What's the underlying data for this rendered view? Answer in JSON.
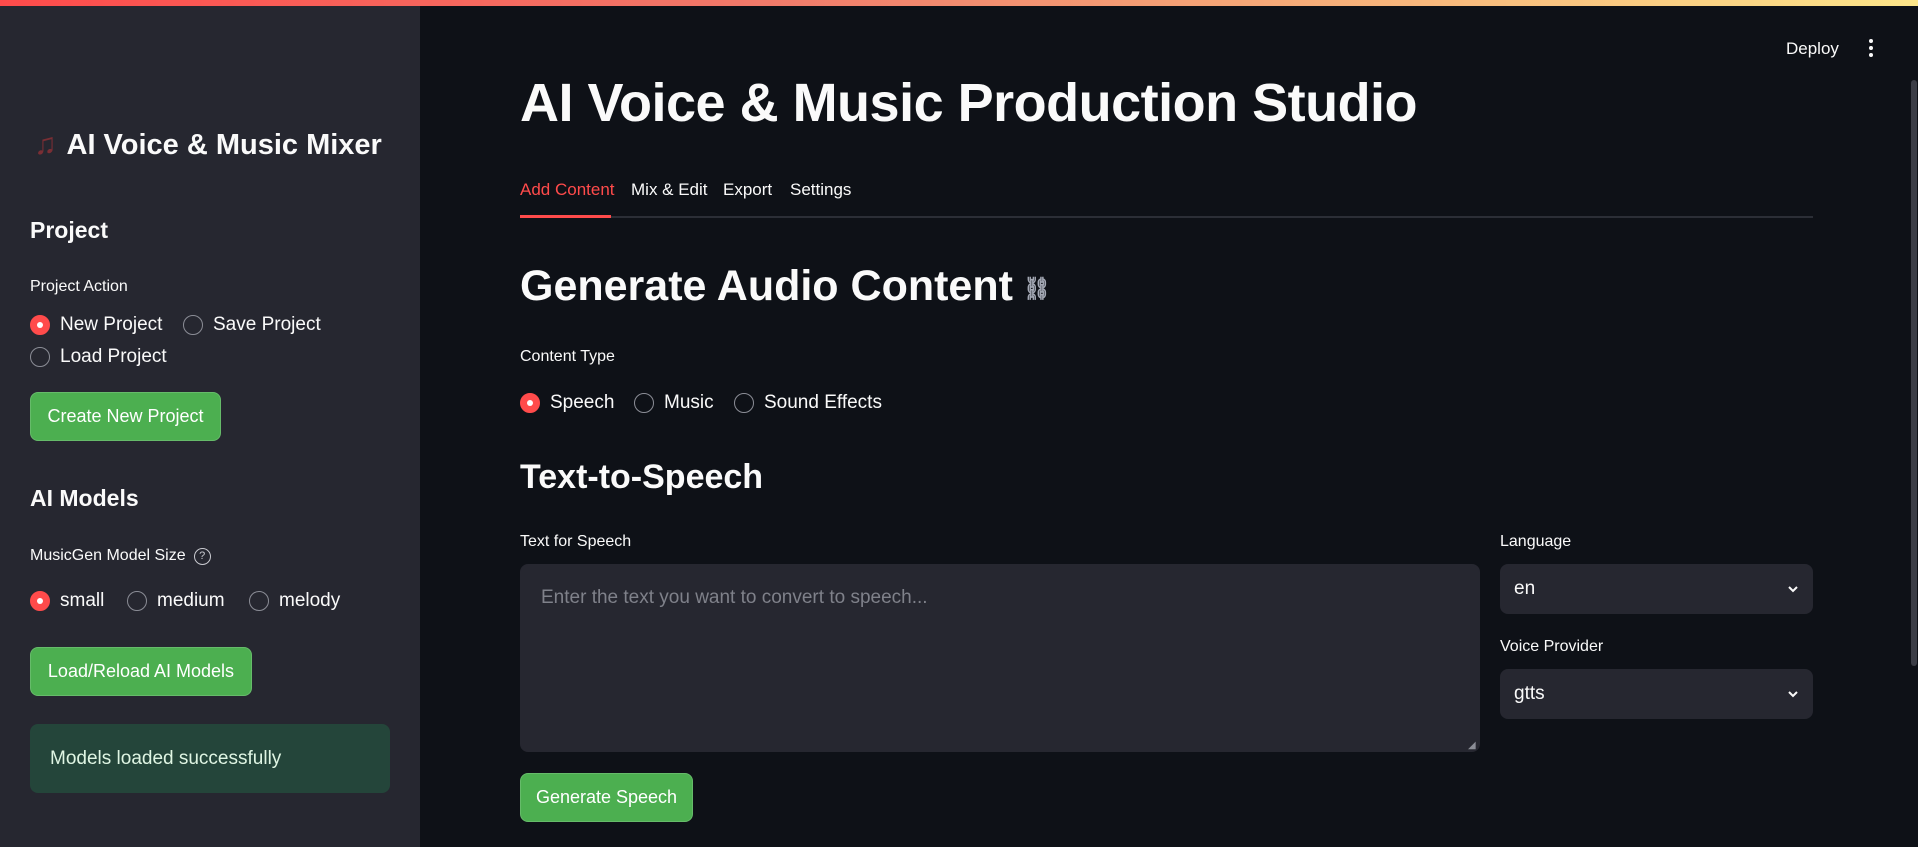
{
  "sidebar": {
    "title": "AI Voice & Music Mixer",
    "title_icon": "music-note-icon",
    "project": {
      "heading": "Project",
      "action_label": "Project Action",
      "options": [
        "New Project",
        "Save Project",
        "Load Project"
      ],
      "selected": "New Project",
      "button": "Create New Project"
    },
    "models": {
      "heading": "AI Models",
      "size_label": "MusicGen Model Size",
      "help": "?",
      "options": [
        "small",
        "medium",
        "melody"
      ],
      "selected": "small",
      "button": "Load/Reload AI Models",
      "status": "Models loaded successfully"
    }
  },
  "header": {
    "deploy": "Deploy"
  },
  "main": {
    "title": "AI Voice & Music Production Studio",
    "tabs": [
      "Add Content",
      "Mix & Edit",
      "Export",
      "Settings"
    ],
    "active_tab": "Add Content",
    "section_title": "Generate Audio Content",
    "content_type": {
      "label": "Content Type",
      "options": [
        "Speech",
        "Music",
        "Sound Effects"
      ],
      "selected": "Speech"
    },
    "tts": {
      "heading": "Text-to-Speech",
      "text_label": "Text for Speech",
      "text_value": "",
      "placeholder": "Enter the text you want to convert to speech...",
      "language_label": "Language",
      "language_value": "en",
      "provider_label": "Voice Provider",
      "provider_value": "gtts",
      "generate_button": "Generate Speech"
    }
  },
  "colors": {
    "accent": "#ff4b4b",
    "button_green": "#4caf50",
    "background": "#0e1117",
    "sidebar": "#262730",
    "success_bg": "#24453a"
  }
}
